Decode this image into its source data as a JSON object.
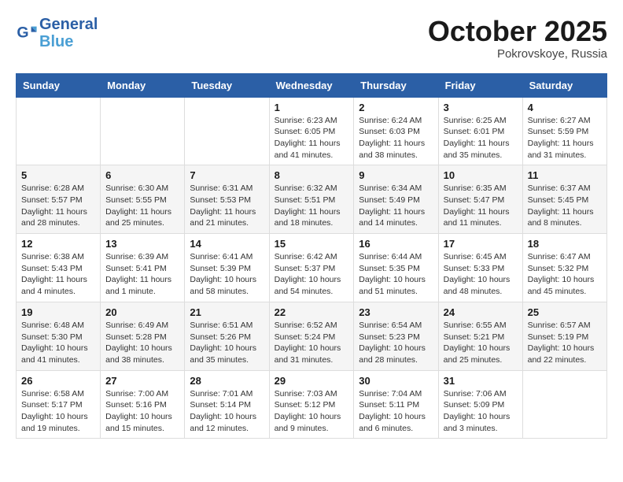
{
  "header": {
    "logo_line1": "General",
    "logo_line2": "Blue",
    "month": "October 2025",
    "location": "Pokrovskoye, Russia"
  },
  "days_of_week": [
    "Sunday",
    "Monday",
    "Tuesday",
    "Wednesday",
    "Thursday",
    "Friday",
    "Saturday"
  ],
  "weeks": [
    [
      {
        "num": "",
        "info": ""
      },
      {
        "num": "",
        "info": ""
      },
      {
        "num": "",
        "info": ""
      },
      {
        "num": "1",
        "info": "Sunrise: 6:23 AM\nSunset: 6:05 PM\nDaylight: 11 hours and 41 minutes."
      },
      {
        "num": "2",
        "info": "Sunrise: 6:24 AM\nSunset: 6:03 PM\nDaylight: 11 hours and 38 minutes."
      },
      {
        "num": "3",
        "info": "Sunrise: 6:25 AM\nSunset: 6:01 PM\nDaylight: 11 hours and 35 minutes."
      },
      {
        "num": "4",
        "info": "Sunrise: 6:27 AM\nSunset: 5:59 PM\nDaylight: 11 hours and 31 minutes."
      }
    ],
    [
      {
        "num": "5",
        "info": "Sunrise: 6:28 AM\nSunset: 5:57 PM\nDaylight: 11 hours and 28 minutes."
      },
      {
        "num": "6",
        "info": "Sunrise: 6:30 AM\nSunset: 5:55 PM\nDaylight: 11 hours and 25 minutes."
      },
      {
        "num": "7",
        "info": "Sunrise: 6:31 AM\nSunset: 5:53 PM\nDaylight: 11 hours and 21 minutes."
      },
      {
        "num": "8",
        "info": "Sunrise: 6:32 AM\nSunset: 5:51 PM\nDaylight: 11 hours and 18 minutes."
      },
      {
        "num": "9",
        "info": "Sunrise: 6:34 AM\nSunset: 5:49 PM\nDaylight: 11 hours and 14 minutes."
      },
      {
        "num": "10",
        "info": "Sunrise: 6:35 AM\nSunset: 5:47 PM\nDaylight: 11 hours and 11 minutes."
      },
      {
        "num": "11",
        "info": "Sunrise: 6:37 AM\nSunset: 5:45 PM\nDaylight: 11 hours and 8 minutes."
      }
    ],
    [
      {
        "num": "12",
        "info": "Sunrise: 6:38 AM\nSunset: 5:43 PM\nDaylight: 11 hours and 4 minutes."
      },
      {
        "num": "13",
        "info": "Sunrise: 6:39 AM\nSunset: 5:41 PM\nDaylight: 11 hours and 1 minute."
      },
      {
        "num": "14",
        "info": "Sunrise: 6:41 AM\nSunset: 5:39 PM\nDaylight: 10 hours and 58 minutes."
      },
      {
        "num": "15",
        "info": "Sunrise: 6:42 AM\nSunset: 5:37 PM\nDaylight: 10 hours and 54 minutes."
      },
      {
        "num": "16",
        "info": "Sunrise: 6:44 AM\nSunset: 5:35 PM\nDaylight: 10 hours and 51 minutes."
      },
      {
        "num": "17",
        "info": "Sunrise: 6:45 AM\nSunset: 5:33 PM\nDaylight: 10 hours and 48 minutes."
      },
      {
        "num": "18",
        "info": "Sunrise: 6:47 AM\nSunset: 5:32 PM\nDaylight: 10 hours and 45 minutes."
      }
    ],
    [
      {
        "num": "19",
        "info": "Sunrise: 6:48 AM\nSunset: 5:30 PM\nDaylight: 10 hours and 41 minutes."
      },
      {
        "num": "20",
        "info": "Sunrise: 6:49 AM\nSunset: 5:28 PM\nDaylight: 10 hours and 38 minutes."
      },
      {
        "num": "21",
        "info": "Sunrise: 6:51 AM\nSunset: 5:26 PM\nDaylight: 10 hours and 35 minutes."
      },
      {
        "num": "22",
        "info": "Sunrise: 6:52 AM\nSunset: 5:24 PM\nDaylight: 10 hours and 31 minutes."
      },
      {
        "num": "23",
        "info": "Sunrise: 6:54 AM\nSunset: 5:23 PM\nDaylight: 10 hours and 28 minutes."
      },
      {
        "num": "24",
        "info": "Sunrise: 6:55 AM\nSunset: 5:21 PM\nDaylight: 10 hours and 25 minutes."
      },
      {
        "num": "25",
        "info": "Sunrise: 6:57 AM\nSunset: 5:19 PM\nDaylight: 10 hours and 22 minutes."
      }
    ],
    [
      {
        "num": "26",
        "info": "Sunrise: 6:58 AM\nSunset: 5:17 PM\nDaylight: 10 hours and 19 minutes."
      },
      {
        "num": "27",
        "info": "Sunrise: 7:00 AM\nSunset: 5:16 PM\nDaylight: 10 hours and 15 minutes."
      },
      {
        "num": "28",
        "info": "Sunrise: 7:01 AM\nSunset: 5:14 PM\nDaylight: 10 hours and 12 minutes."
      },
      {
        "num": "29",
        "info": "Sunrise: 7:03 AM\nSunset: 5:12 PM\nDaylight: 10 hours and 9 minutes."
      },
      {
        "num": "30",
        "info": "Sunrise: 7:04 AM\nSunset: 5:11 PM\nDaylight: 10 hours and 6 minutes."
      },
      {
        "num": "31",
        "info": "Sunrise: 7:06 AM\nSunset: 5:09 PM\nDaylight: 10 hours and 3 minutes."
      },
      {
        "num": "",
        "info": ""
      }
    ]
  ]
}
